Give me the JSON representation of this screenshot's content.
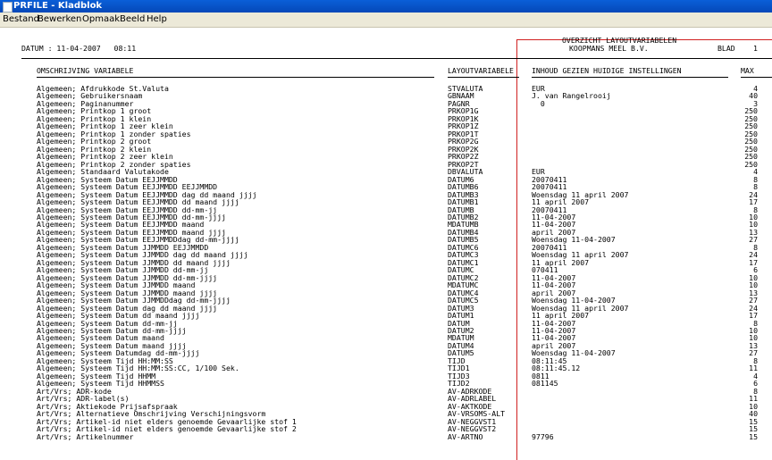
{
  "window": {
    "title": "PRFILE - Kladblok"
  },
  "menu": [
    "Bestand",
    "Bewerken",
    "Opmaak",
    "Beeld",
    "Help"
  ],
  "report": {
    "date_line": "DATUM : 11-04-2007   08:11",
    "title": "OVERZICHT LAYOUTVARIABELEN",
    "company": "KOOPMANS MEEL B.V.",
    "page_label": "BLAD",
    "page_number": "1",
    "headers": {
      "omschrijving": "OMSCHRIJVING VARIABELE",
      "layoutvariabele": "LAYOUTVARIABELE",
      "inhoud": "INHOUD GEZIEN HUIDIGE INSTELLINGEN",
      "max": "MAX"
    },
    "rows": [
      [
        "Algemeen; Afdrukkode St.Valuta",
        "STVALUTA",
        "EUR",
        "4"
      ],
      [
        "Algemeen; Gebruikersnaam",
        "GBNAAM",
        "J. van Rangelrooij",
        "40"
      ],
      [
        "Algemeen; Paginanummer",
        "PAGNR",
        "  0",
        "3"
      ],
      [
        "Algemeen; Printkop 1 groot",
        "PRKOP1G",
        "",
        "250"
      ],
      [
        "Algemeen; Printkop 1 klein",
        "PRKOP1K",
        "",
        "250"
      ],
      [
        "Algemeen; Printkop 1 zeer klein",
        "PRKOP1Z",
        "",
        "250"
      ],
      [
        "Algemeen; Printkop 1 zonder spaties",
        "PRKOP1T",
        "",
        "250"
      ],
      [
        "Algemeen; Printkop 2 groot",
        "PRKOP2G",
        "",
        "250"
      ],
      [
        "Algemeen; Printkop 2 klein",
        "PRKOP2K",
        "",
        "250"
      ],
      [
        "Algemeen; Printkop 2 zeer klein",
        "PRKOP2Z",
        "",
        "250"
      ],
      [
        "Algemeen; Printkop 2 zonder spaties",
        "PRKOP2T",
        "",
        "250"
      ],
      [
        "Algemeen; Standaard Valutakode",
        "DBVALUTA",
        "EUR",
        "4"
      ],
      [
        "Algemeen; Systeem Datum EEJJMMDD",
        "DATUM6",
        "20070411",
        "8"
      ],
      [
        "Algemeen; Systeem Datum EEJJMMDD EEJJMMDD",
        "DATUMB6",
        "20070411",
        "8"
      ],
      [
        "Algemeen; Systeem Datum EEJJMMDD dag dd maand jjjj",
        "DATUMB3",
        "Woensdag 11 april 2007",
        "24"
      ],
      [
        "Algemeen; Systeem Datum EEJJMMDD dd maand jjjj",
        "DATUMB1",
        "11 april 2007",
        "17"
      ],
      [
        "Algemeen; Systeem Datum EEJJMMDD dd-mm-jj",
        "DATUMB",
        "20070411",
        "8"
      ],
      [
        "Algemeen; Systeem Datum EEJJMMDD dd-mm-jjjj",
        "DATUMB2",
        "11-04-2007",
        "10"
      ],
      [
        "Algemeen; Systeem Datum EEJJMMDD maand",
        "MDATUMB",
        "11-04-2007",
        "10"
      ],
      [
        "Algemeen; Systeem Datum EEJJMMDD maand jjjj",
        "DATUMB4",
        "april 2007",
        "13"
      ],
      [
        "Algemeen; Systeem Datum EEJJMMDDdag dd-mm-jjjj",
        "DATUMB5",
        "Woensdag 11-04-2007",
        "27"
      ],
      [
        "Algemeen; Systeem Datum JJMMDD EEJJMMDD",
        "DATUMC6",
        "20070411",
        "8"
      ],
      [
        "Algemeen; Systeem Datum JJMMDD dag dd maand jjjj",
        "DATUMC3",
        "Woensdag 11 april 2007",
        "24"
      ],
      [
        "Algemeen; Systeem Datum JJMMDD dd maand jjjj",
        "DATUMC1",
        "11 april 2007",
        "17"
      ],
      [
        "Algemeen; Systeem Datum JJMMDD dd-mm-jj",
        "DATUMC",
        "070411",
        "6"
      ],
      [
        "Algemeen; Systeem Datum JJMMDD dd-mm-jjjj",
        "DATUMC2",
        "11-04-2007",
        "10"
      ],
      [
        "Algemeen; Systeem Datum JJMMDD maand",
        "MDATUMC",
        "11-04-2007",
        "10"
      ],
      [
        "Algemeen; Systeem Datum JJMMDD maand jjjj",
        "DATUMC4",
        "april 2007",
        "13"
      ],
      [
        "Algemeen; Systeem Datum JJMMDDdag dd-mm-jjjj",
        "DATUMC5",
        "Woensdag 11-04-2007",
        "27"
      ],
      [
        "Algemeen; Systeem Datum dag dd maand jjjj",
        "DATUM3",
        "Woensdag 11 april 2007",
        "24"
      ],
      [
        "Algemeen; Systeem Datum dd maand jjjj",
        "DATUM1",
        "11 april 2007",
        "17"
      ],
      [
        "Algemeen; Systeem Datum dd-mm-jj",
        "DATUM",
        "11-04-2007",
        "8"
      ],
      [
        "Algemeen; Systeem Datum dd-mm-jjjj",
        "DATUM2",
        "11-04-2007",
        "10"
      ],
      [
        "Algemeen; Systeem Datum maand",
        "MDATUM",
        "11-04-2007",
        "10"
      ],
      [
        "Algemeen; Systeem Datum maand jjjj",
        "DATUM4",
        "april 2007",
        "13"
      ],
      [
        "Algemeen; Systeem Datumdag dd-mm-jjjj",
        "DATUM5",
        "Woensdag 11-04-2007",
        "27"
      ],
      [
        "Algemeen; Systeem Tijd HH:MM:SS",
        "TIJD",
        "08:11:45",
        "8"
      ],
      [
        "Algemeen; Systeem Tijd HH:MM:SS:CC, 1/100 Sek.",
        "TIJD1",
        "08:11:45.12",
        "11"
      ],
      [
        "Algemeen; Systeem Tijd HHMM",
        "TIJD3",
        "0811",
        "4"
      ],
      [
        "Algemeen; Systeem Tijd HHMMSS",
        "TIJD2",
        "081145",
        "6"
      ],
      [
        "Art/Vrs; ADR-kode",
        "AV-ADRKODE",
        "",
        "8"
      ],
      [
        "Art/Vrs; ADR-label(s)",
        "AV-ADRLABEL",
        "",
        "11"
      ],
      [
        "Art/Vrs; Aktiekode Prijsafspraak",
        "AV-AKTKODE",
        "",
        "10"
      ],
      [
        "Art/Vrs; Alternatieve Omschrijving Verschijningsvorm",
        "AV-VRSOMS-ALT",
        "",
        "40"
      ],
      [
        "Art/Vrs; Artikel-id niet elders genoemde Gevaarlijke stof 1",
        "AV-NEGGVST1",
        "",
        "15"
      ],
      [
        "Art/Vrs; Artikel-id niet elders genoemde Gevaarlijke stof 2",
        "AV-NEGGVST2",
        "",
        "15"
      ],
      [
        "Art/Vrs; Artikelnummer",
        "AV-ARTNO",
        "97796",
        "15"
      ]
    ]
  }
}
